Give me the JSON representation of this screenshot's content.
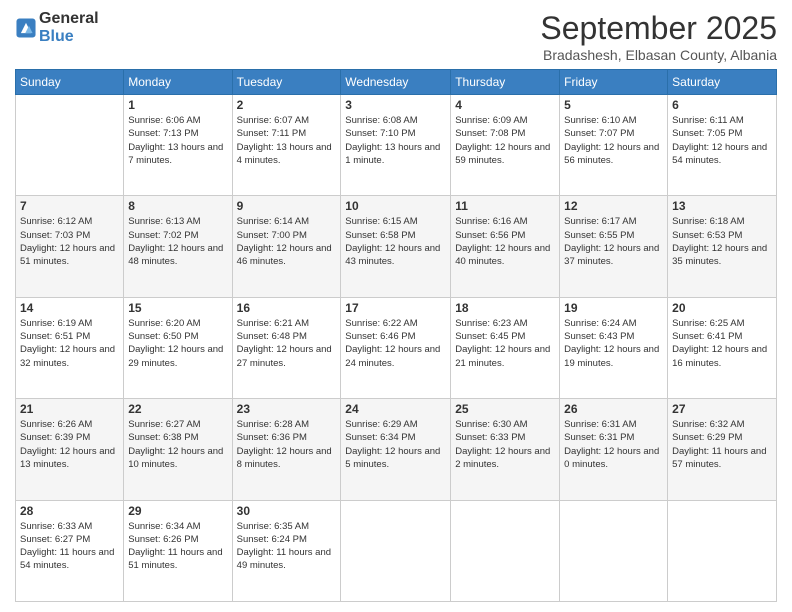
{
  "logo": {
    "general": "General",
    "blue": "Blue"
  },
  "title": "September 2025",
  "location": "Bradashesh, Elbasan County, Albania",
  "headers": [
    "Sunday",
    "Monday",
    "Tuesday",
    "Wednesday",
    "Thursday",
    "Friday",
    "Saturday"
  ],
  "weeks": [
    [
      {
        "day": "",
        "sunrise": "",
        "sunset": "",
        "daylight": ""
      },
      {
        "day": "1",
        "sunrise": "6:06 AM",
        "sunset": "7:13 PM",
        "daylight": "13 hours and 7 minutes."
      },
      {
        "day": "2",
        "sunrise": "6:07 AM",
        "sunset": "7:11 PM",
        "daylight": "13 hours and 4 minutes."
      },
      {
        "day": "3",
        "sunrise": "6:08 AM",
        "sunset": "7:10 PM",
        "daylight": "13 hours and 1 minute."
      },
      {
        "day": "4",
        "sunrise": "6:09 AM",
        "sunset": "7:08 PM",
        "daylight": "12 hours and 59 minutes."
      },
      {
        "day": "5",
        "sunrise": "6:10 AM",
        "sunset": "7:07 PM",
        "daylight": "12 hours and 56 minutes."
      },
      {
        "day": "6",
        "sunrise": "6:11 AM",
        "sunset": "7:05 PM",
        "daylight": "12 hours and 54 minutes."
      }
    ],
    [
      {
        "day": "7",
        "sunrise": "6:12 AM",
        "sunset": "7:03 PM",
        "daylight": "12 hours and 51 minutes."
      },
      {
        "day": "8",
        "sunrise": "6:13 AM",
        "sunset": "7:02 PM",
        "daylight": "12 hours and 48 minutes."
      },
      {
        "day": "9",
        "sunrise": "6:14 AM",
        "sunset": "7:00 PM",
        "daylight": "12 hours and 46 minutes."
      },
      {
        "day": "10",
        "sunrise": "6:15 AM",
        "sunset": "6:58 PM",
        "daylight": "12 hours and 43 minutes."
      },
      {
        "day": "11",
        "sunrise": "6:16 AM",
        "sunset": "6:56 PM",
        "daylight": "12 hours and 40 minutes."
      },
      {
        "day": "12",
        "sunrise": "6:17 AM",
        "sunset": "6:55 PM",
        "daylight": "12 hours and 37 minutes."
      },
      {
        "day": "13",
        "sunrise": "6:18 AM",
        "sunset": "6:53 PM",
        "daylight": "12 hours and 35 minutes."
      }
    ],
    [
      {
        "day": "14",
        "sunrise": "6:19 AM",
        "sunset": "6:51 PM",
        "daylight": "12 hours and 32 minutes."
      },
      {
        "day": "15",
        "sunrise": "6:20 AM",
        "sunset": "6:50 PM",
        "daylight": "12 hours and 29 minutes."
      },
      {
        "day": "16",
        "sunrise": "6:21 AM",
        "sunset": "6:48 PM",
        "daylight": "12 hours and 27 minutes."
      },
      {
        "day": "17",
        "sunrise": "6:22 AM",
        "sunset": "6:46 PM",
        "daylight": "12 hours and 24 minutes."
      },
      {
        "day": "18",
        "sunrise": "6:23 AM",
        "sunset": "6:45 PM",
        "daylight": "12 hours and 21 minutes."
      },
      {
        "day": "19",
        "sunrise": "6:24 AM",
        "sunset": "6:43 PM",
        "daylight": "12 hours and 19 minutes."
      },
      {
        "day": "20",
        "sunrise": "6:25 AM",
        "sunset": "6:41 PM",
        "daylight": "12 hours and 16 minutes."
      }
    ],
    [
      {
        "day": "21",
        "sunrise": "6:26 AM",
        "sunset": "6:39 PM",
        "daylight": "12 hours and 13 minutes."
      },
      {
        "day": "22",
        "sunrise": "6:27 AM",
        "sunset": "6:38 PM",
        "daylight": "12 hours and 10 minutes."
      },
      {
        "day": "23",
        "sunrise": "6:28 AM",
        "sunset": "6:36 PM",
        "daylight": "12 hours and 8 minutes."
      },
      {
        "day": "24",
        "sunrise": "6:29 AM",
        "sunset": "6:34 PM",
        "daylight": "12 hours and 5 minutes."
      },
      {
        "day": "25",
        "sunrise": "6:30 AM",
        "sunset": "6:33 PM",
        "daylight": "12 hours and 2 minutes."
      },
      {
        "day": "26",
        "sunrise": "6:31 AM",
        "sunset": "6:31 PM",
        "daylight": "12 hours and 0 minutes."
      },
      {
        "day": "27",
        "sunrise": "6:32 AM",
        "sunset": "6:29 PM",
        "daylight": "11 hours and 57 minutes."
      }
    ],
    [
      {
        "day": "28",
        "sunrise": "6:33 AM",
        "sunset": "6:27 PM",
        "daylight": "11 hours and 54 minutes."
      },
      {
        "day": "29",
        "sunrise": "6:34 AM",
        "sunset": "6:26 PM",
        "daylight": "11 hours and 51 minutes."
      },
      {
        "day": "30",
        "sunrise": "6:35 AM",
        "sunset": "6:24 PM",
        "daylight": "11 hours and 49 minutes."
      },
      {
        "day": "",
        "sunrise": "",
        "sunset": "",
        "daylight": ""
      },
      {
        "day": "",
        "sunrise": "",
        "sunset": "",
        "daylight": ""
      },
      {
        "day": "",
        "sunrise": "",
        "sunset": "",
        "daylight": ""
      },
      {
        "day": "",
        "sunrise": "",
        "sunset": "",
        "daylight": ""
      }
    ]
  ],
  "sunrise_label": "Sunrise:",
  "sunset_label": "Sunset:",
  "daylight_label": "Daylight:"
}
